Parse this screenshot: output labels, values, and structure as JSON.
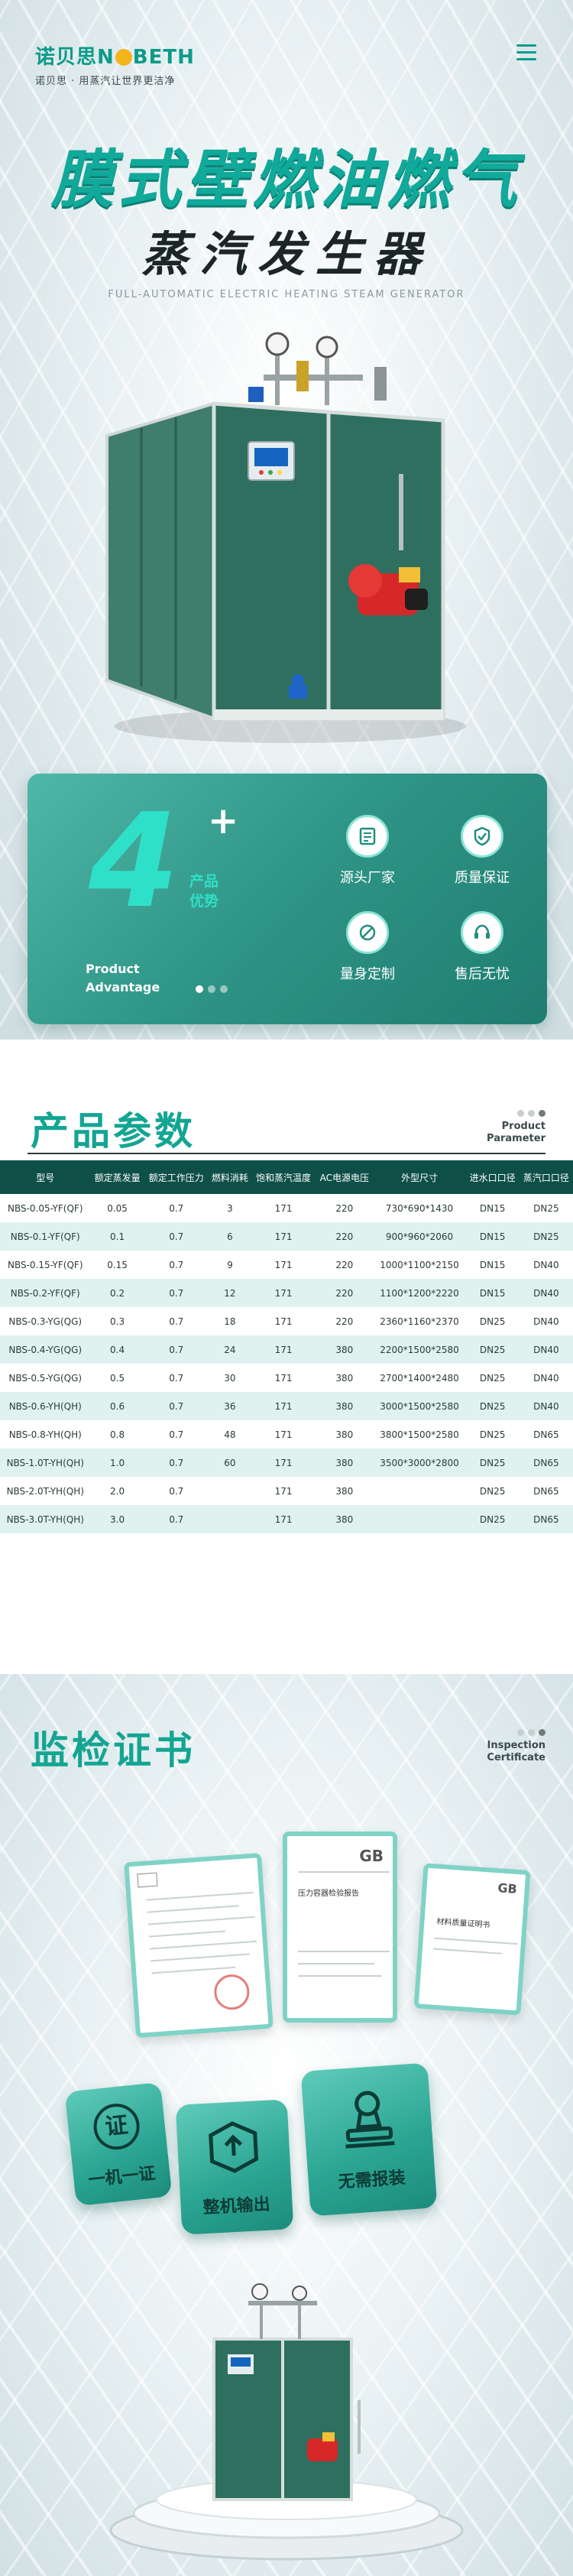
{
  "brand": {
    "name_cn": "诺贝思",
    "name_en_prefix": "N",
    "name_en_suffix": "BETH",
    "slogan": "诺贝思 · 用蒸汽让世界更洁净"
  },
  "hero": {
    "title": "膜式壁燃油燃气",
    "subtitle": "蒸汽发生器",
    "english": "FULL-AUTOMATIC ELECTRIC HEATING STEAM GENERATOR"
  },
  "advantage": {
    "number": "4",
    "plus": "+",
    "label_line1": "产品",
    "label_line2": "优势",
    "en_line1": "Product",
    "en_line2": "Advantage",
    "items": [
      {
        "label": "源头厂家",
        "icon": "factory-icon"
      },
      {
        "label": "质量保证",
        "icon": "quality-icon"
      },
      {
        "label": "量身定制",
        "icon": "custom-icon"
      },
      {
        "label": "售后无忧",
        "icon": "service-icon"
      }
    ]
  },
  "params": {
    "title": "产品参数",
    "en_line1": "Product",
    "en_line2": "Parameter",
    "headers": [
      "型号",
      "额定蒸发量",
      "额定工作压力",
      "燃料消耗",
      "饱和蒸汽温度",
      "AC电源电压",
      "外型尺寸",
      "进水口口径",
      "蒸汽口口径"
    ],
    "rows": [
      [
        "NBS-0.05-YF(QF)",
        "0.05",
        "0.7",
        "3",
        "171",
        "220",
        "730*690*1430",
        "DN15",
        "DN25"
      ],
      [
        "NBS-0.1-YF(QF)",
        "0.1",
        "0.7",
        "6",
        "171",
        "220",
        "900*960*2060",
        "DN15",
        "DN25"
      ],
      [
        "NBS-0.15-YF(QF)",
        "0.15",
        "0.7",
        "9",
        "171",
        "220",
        "1000*1100*2150",
        "DN15",
        "DN40"
      ],
      [
        "NBS-0.2-YF(QF)",
        "0.2",
        "0.7",
        "12",
        "171",
        "220",
        "1100*1200*2220",
        "DN15",
        "DN40"
      ],
      [
        "NBS-0.3-YG(QG)",
        "0.3",
        "0.7",
        "18",
        "171",
        "220",
        "2360*1160*2370",
        "DN25",
        "DN40"
      ],
      [
        "NBS-0.4-YG(QG)",
        "0.4",
        "0.7",
        "24",
        "171",
        "380",
        "2200*1500*2580",
        "DN25",
        "DN40"
      ],
      [
        "NBS-0.5-YG(QG)",
        "0.5",
        "0.7",
        "30",
        "171",
        "380",
        "2700*1400*2480",
        "DN25",
        "DN40"
      ],
      [
        "NBS-0.6-YH(QH)",
        "0.6",
        "0.7",
        "36",
        "171",
        "380",
        "3000*1500*2580",
        "DN25",
        "DN40"
      ],
      [
        "NBS-0.8-YH(QH)",
        "0.8",
        "0.7",
        "48",
        "171",
        "380",
        "3800*1500*2580",
        "DN25",
        "DN65"
      ],
      [
        "NBS-1.0T-YH(QH)",
        "1.0",
        "0.7",
        "60",
        "171",
        "380",
        "3500*3000*2800",
        "DN25",
        "DN65"
      ],
      [
        "NBS-2.0T-YH(QH)",
        "2.0",
        "0.7",
        "",
        "171",
        "380",
        "",
        "DN25",
        "DN65"
      ],
      [
        "NBS-3.0T-YH(QH)",
        "3.0",
        "0.7",
        "",
        "171",
        "380",
        "",
        "DN25",
        "DN65"
      ]
    ]
  },
  "certs": {
    "title": "监检证书",
    "en_line1": "Inspection",
    "en_line2": "Certificate",
    "doc_right_title": "材料质量证明书",
    "doc_middle_title": "压力容器检验报告",
    "doc_middle_logo": "GB",
    "doc_right_logo": "GB",
    "tiles": [
      {
        "label": "一机一证",
        "icon_char": "证"
      },
      {
        "label": "整机输出",
        "icon": "box-upload-icon"
      },
      {
        "label": "无需报装",
        "icon": "stamp-icon"
      }
    ]
  },
  "colors": {
    "brand_teal": "#13a592",
    "table_header": "#0e4f47",
    "row_alt": "#dff2ef",
    "machine_green": "#2f6f5f"
  }
}
